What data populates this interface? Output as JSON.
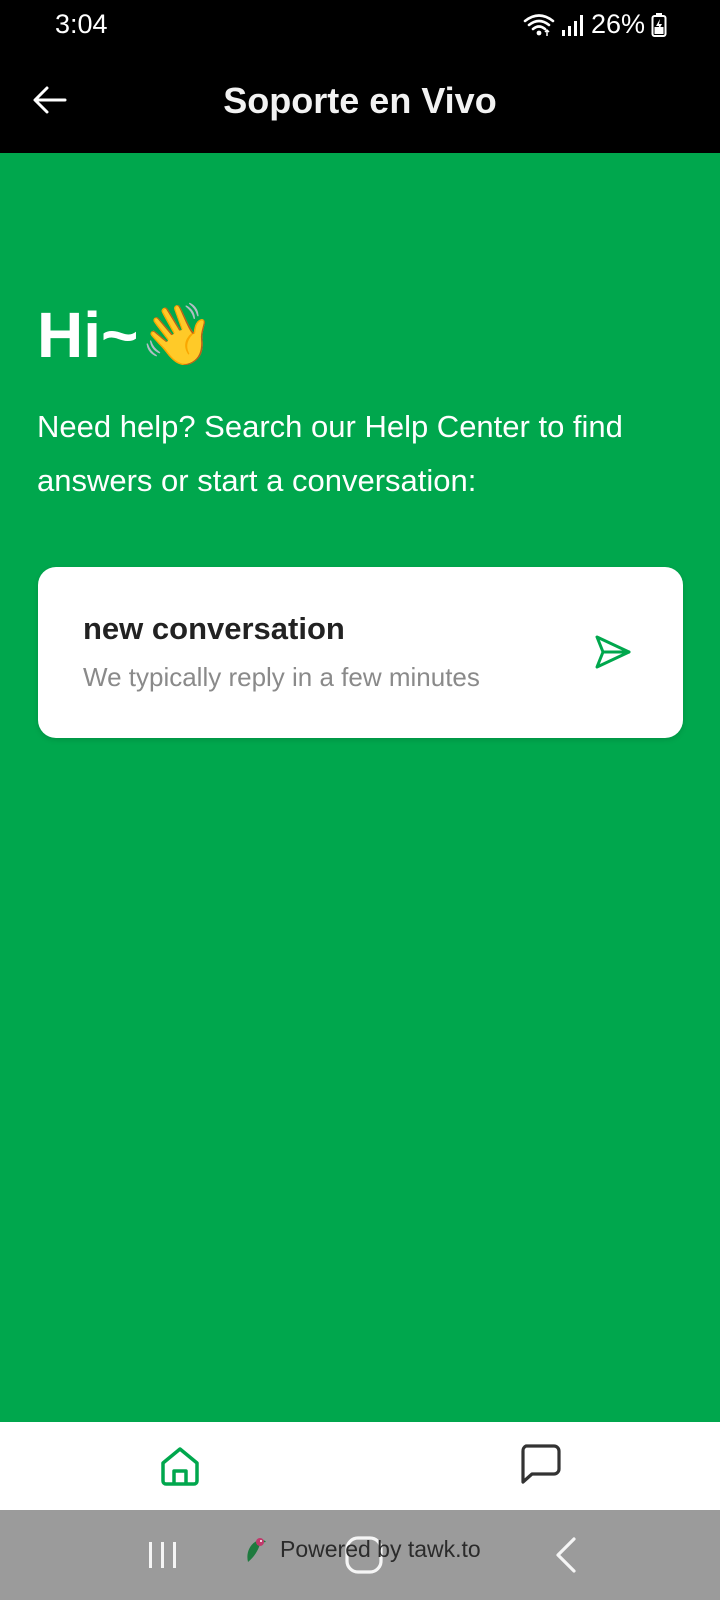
{
  "status_bar": {
    "time": "3:04",
    "battery_text": "26%"
  },
  "app_bar": {
    "title": "Soporte en Vivo"
  },
  "main": {
    "greeting": "Hi~",
    "greeting_emoji": "👋",
    "intro": "Need help? Search our Help Center to find answers or start a conversation:",
    "card": {
      "title": "new conversation",
      "subtitle": "We typically reply in a few minutes"
    }
  },
  "footer": {
    "powered_by": "Powered by tawk.to"
  },
  "colors": {
    "brand_green": "#00a74d",
    "bar_black": "#000000"
  },
  "icons": {
    "back": "arrow-left-icon",
    "send": "send-icon",
    "home": "home-icon",
    "chat": "chat-bubble-icon",
    "wifi": "wifi-icon",
    "signal": "signal-icon",
    "battery": "battery-charging-icon"
  }
}
